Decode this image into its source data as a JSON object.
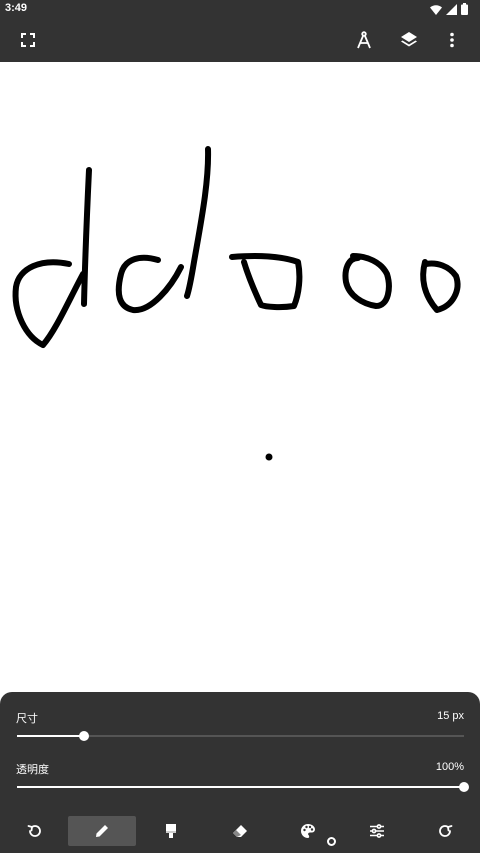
{
  "status_bar": {
    "time": "3:49",
    "icons": [
      "wifi-icon",
      "signal-icon",
      "battery-icon"
    ]
  },
  "toolbar": {
    "left": [
      "fullscreen-icon"
    ],
    "right": [
      "compass-icon",
      "layers-icon",
      "more-vert-icon"
    ]
  },
  "canvas": {
    "background": "#ffffff",
    "stroke_color": "#000000",
    "content": "hand-drawn strokes"
  },
  "panel": {
    "size": {
      "label": "尺寸",
      "value_text": "15 px",
      "fraction": 0.15
    },
    "opacity": {
      "label": "透明度",
      "value_text": "100%",
      "fraction": 1.0
    }
  },
  "tools": {
    "items": [
      "undo-icon",
      "pencil-icon",
      "brush-icon",
      "eraser-icon",
      "palette-icon",
      "sliders-icon",
      "redo-icon"
    ],
    "active": "pencil-icon"
  },
  "colors": {
    "bar_background": "#333333",
    "active_tool_background": "#555555"
  }
}
